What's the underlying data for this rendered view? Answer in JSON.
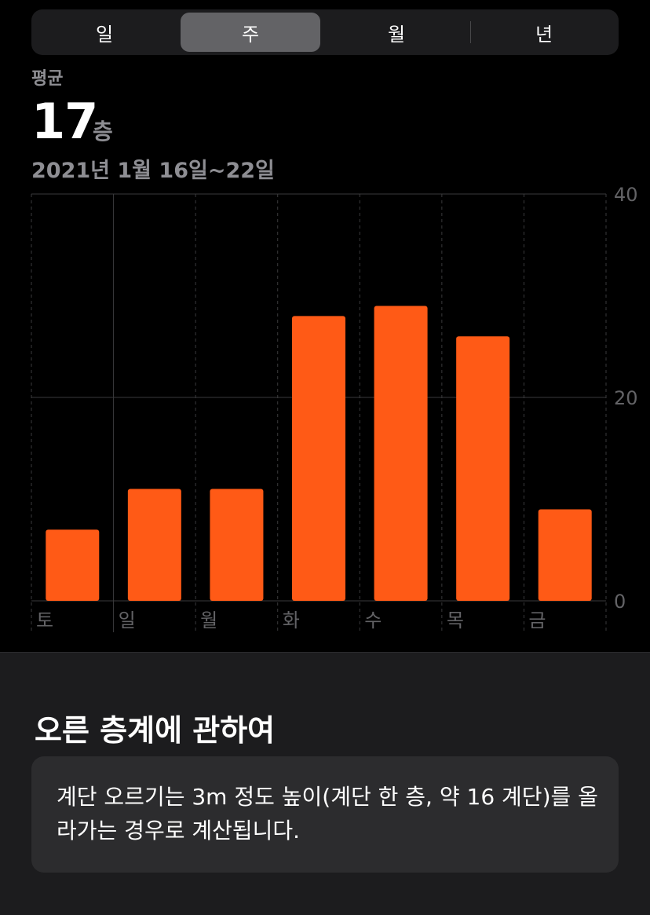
{
  "segments": [
    {
      "label": "일",
      "active": false
    },
    {
      "label": "주",
      "active": true
    },
    {
      "label": "월",
      "active": false
    },
    {
      "label": "년",
      "active": false
    }
  ],
  "summary": {
    "label": "평균",
    "value": "17",
    "unit": "층",
    "date_range": "2021년 1월 16일~22일"
  },
  "chart_data": {
    "type": "bar",
    "categories": [
      "토",
      "일",
      "월",
      "화",
      "수",
      "목",
      "금"
    ],
    "values": [
      7,
      11,
      11,
      28,
      29,
      26,
      9
    ],
    "ylim": [
      0,
      40
    ],
    "yticks": [
      "0",
      "20",
      "40"
    ],
    "bar_color": "#ff5a16",
    "grid": true
  },
  "about": {
    "title": "오른 층계에 관하여",
    "text": "계단 오르기는 3m 정도 높이(계단 한 층, 약 16 계단)를 올라가는 경우로 계산됩니다."
  }
}
